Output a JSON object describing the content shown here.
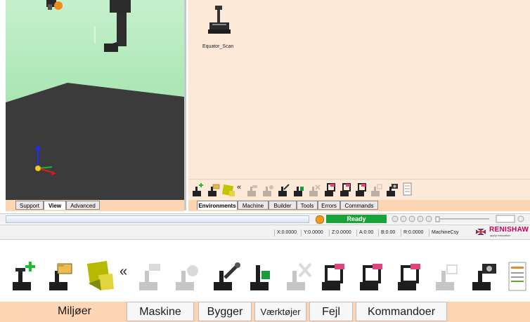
{
  "viewport": {
    "tabs": [
      "Support",
      "View",
      "Advanced"
    ],
    "active_tab": "View"
  },
  "environments": {
    "items": [
      {
        "label": "Equator_Scan",
        "icon": "equator-machine-icon"
      }
    ]
  },
  "small_toolbar": {
    "collapse_glyph": "«",
    "icons": [
      "add-environment-icon",
      "open-environment-icon",
      "environment-settings-icon",
      "collapse-icon",
      "machine-disabled-icon",
      "machine-check-disabled-icon",
      "machine-tools-icon",
      "machine-probe-icon",
      "machine-delete-disabled-icon",
      "machine-builder-icon",
      "machine-builder-2-icon",
      "machine-builder-3-icon",
      "machine-copy-disabled-icon",
      "camera-icon",
      "report-icon"
    ]
  },
  "panel_tabs": [
    "Environments",
    "Machine",
    "Builder",
    "Tools",
    "Errors",
    "Commands"
  ],
  "status": {
    "text": "Ready",
    "color": "#1aa33a",
    "coords": [
      "X:0.0000",
      "Y:0.0000",
      "Z:0.0000",
      "A:0.00",
      "B:0.00",
      "R:0.0000",
      "MachineCsy"
    ],
    "brand": "RENISHAW",
    "brand_tagline": "apply innovation",
    "brand_color": "#c8005a"
  },
  "big_toolbar": {
    "collapse_glyph": "«"
  },
  "big_tabs": [
    "Miljøer",
    "Maskine",
    "Bygger",
    "Værktøjer",
    "Fejl",
    "Kommandoer"
  ]
}
